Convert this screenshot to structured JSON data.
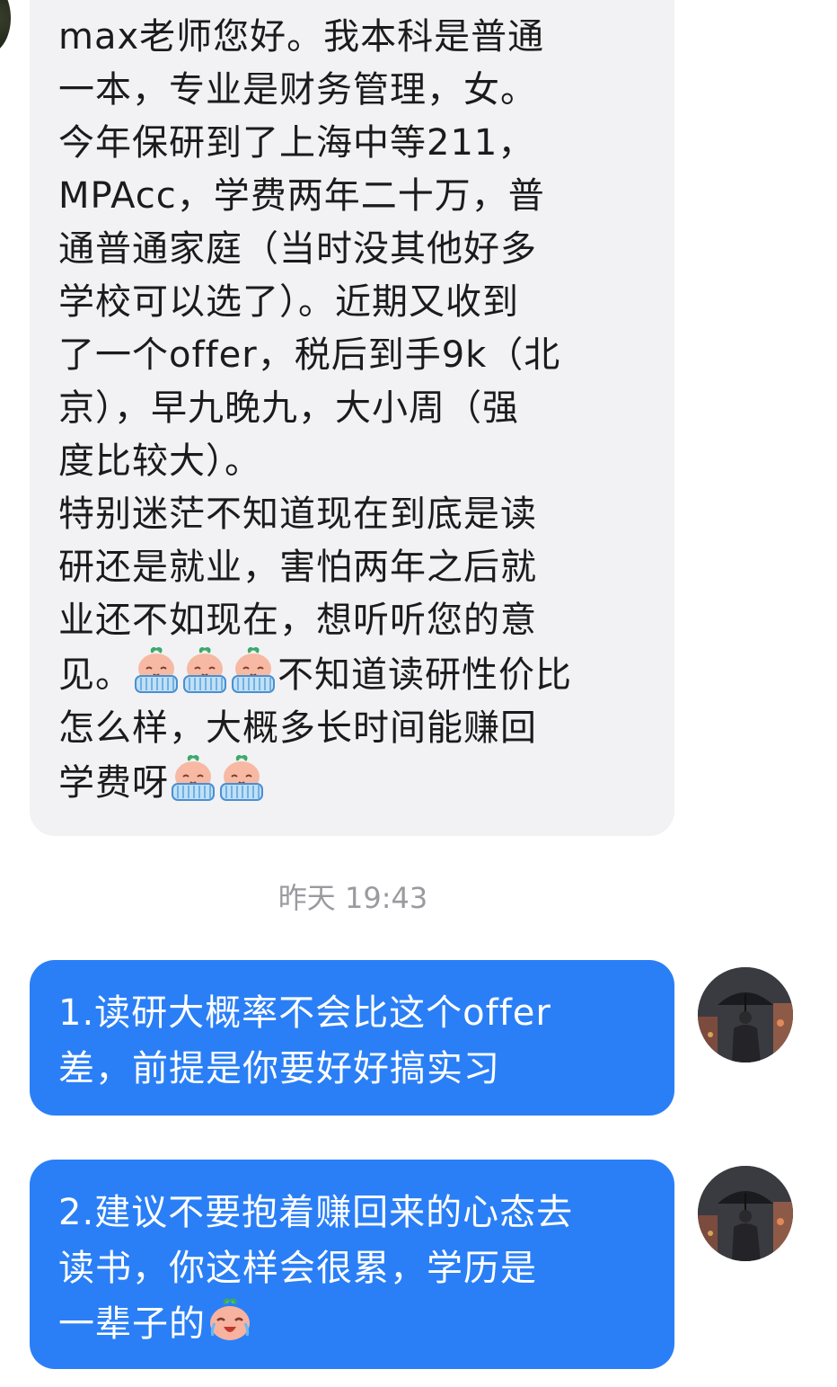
{
  "incoming_message": {
    "lines": [
      "max老师您好。我本科是普通",
      "一本，专业是财务管理，女。",
      "今年保研到了上海中等211，",
      "MPAcc，学费两年二十万，普",
      "通普通家庭（当时没其他好多",
      "学校可以选了）。近期又收到",
      "了一个offer，税后到手9k（北",
      "京），早九晚九，大小周（强",
      "度比较大）。",
      "特别迷茫不知道现在到底是读",
      "研还是就业，害怕两年之后就",
      "业还不如现在，想听听您的意"
    ],
    "line13_before": "见。",
    "line13_after": "不知道读研性价比",
    "line14": "怎么样，大概多长时间能赚回",
    "line15": "学费呀"
  },
  "timestamp": "昨天 19:43",
  "outgoing_messages": [
    {
      "lines": [
        "1.读研大概率不会比这个offer",
        "差，前提是你要好好搞实习"
      ]
    },
    {
      "lines": [
        "2.建议不要抱着赚回来的心态去",
        "读书，你这样会很累，学历是"
      ],
      "last_line": "一辈子的"
    }
  ],
  "emoji_names": {
    "crying_tissue": "crying-peach-emoji",
    "laugh_cry": "laughing-crying-peach-emoji"
  },
  "colors": {
    "outgoing_bubble": "#2a7ff6",
    "incoming_bubble": "#f2f2f4",
    "timestamp_text": "#9a9a9f"
  }
}
